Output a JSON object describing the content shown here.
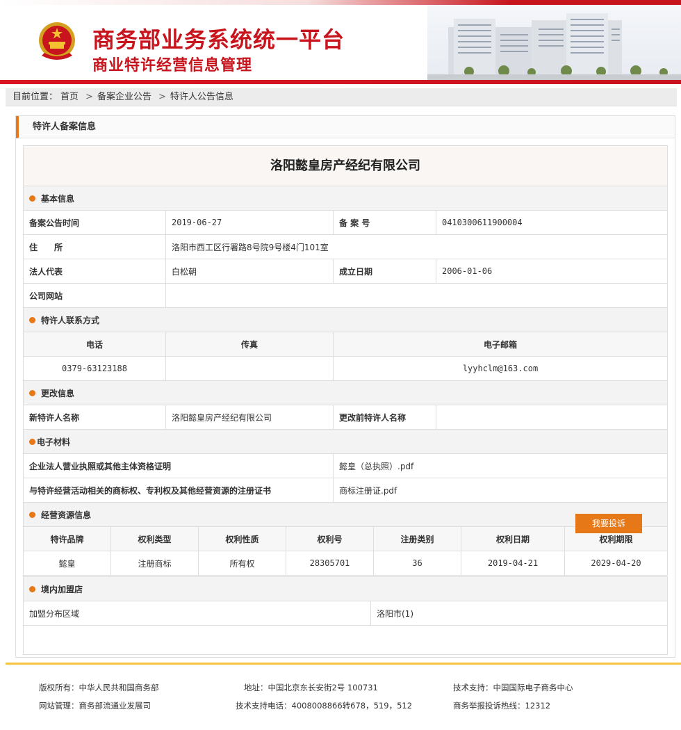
{
  "header": {
    "title_main": "商务部业务系统统一平台",
    "title_sub": "商业特许经营信息管理"
  },
  "breadcrumb": {
    "prefix": "目前位置：",
    "items": [
      "首页",
      "备案企业公告",
      "特许人公告信息"
    ],
    "separator": ">"
  },
  "panel": {
    "title": "特许人备案信息",
    "company_name": "洛阳懿皇房产经纪有限公司"
  },
  "basic": {
    "section": "基本信息",
    "filing_date_label": "备案公告时间",
    "filing_date": "2019-06-27",
    "record_no_label": "备 案 号",
    "record_no": "0410300611900004",
    "address_label": "住　　所",
    "address": "洛阳市西工区行署路8号院9号楼4门101室",
    "legal_rep_label": "法人代表",
    "legal_rep": "白松朝",
    "founded_label": "成立日期",
    "founded": "2006-01-06",
    "website_label": "公司网站",
    "website": ""
  },
  "contact": {
    "section": "特许人联系方式",
    "headers": [
      "电话",
      "传真",
      "电子邮箱"
    ],
    "phone": "0379-63123188",
    "fax": "",
    "email": "lyyhclm@163.com"
  },
  "change": {
    "section": "更改信息",
    "new_name_label": "新特许人名称",
    "new_name": "洛阳懿皇房产经纪有限公司",
    "old_name_label": "更改前特许人名称",
    "old_name": ""
  },
  "materials": {
    "section": "电子材料",
    "items": [
      {
        "label": "企业法人营业执照或其他主体资格证明",
        "file": "懿皇（总执照）.pdf"
      },
      {
        "label": "与特许经营活动相关的商标权、专利权及其他经营资源的注册证书",
        "file": "商标注册证.pdf"
      }
    ]
  },
  "resources": {
    "section": "经营资源信息",
    "headers": [
      "特许品牌",
      "权利类型",
      "权利性质",
      "权利号",
      "注册类别",
      "权利日期",
      "权利期限"
    ],
    "rows": [
      [
        "懿皇",
        "注册商标",
        "所有权",
        "28305701",
        "36",
        "2019-04-21",
        "2029-04-20"
      ]
    ]
  },
  "stores": {
    "section": "境内加盟店",
    "area_label": "加盟分布区域",
    "area_value": "洛阳市(1)"
  },
  "complaint_button": "我要投诉",
  "footer": {
    "copyright": "版权所有：中华人民共和国商务部",
    "address": "地址：中国北京东长安街2号 100731",
    "tech_support": "技术支持：中国国际电子商务中心",
    "site_admin": "网站管理：商务部流通业发展司",
    "tech_phone": "技术支持电话：4008008866转678，519，512",
    "hotline": "商务举报投诉热线：12312"
  },
  "colors": {
    "brand_red": "#c8141c",
    "accent_orange": "#e67817",
    "footer_gold": "#f5c342"
  }
}
